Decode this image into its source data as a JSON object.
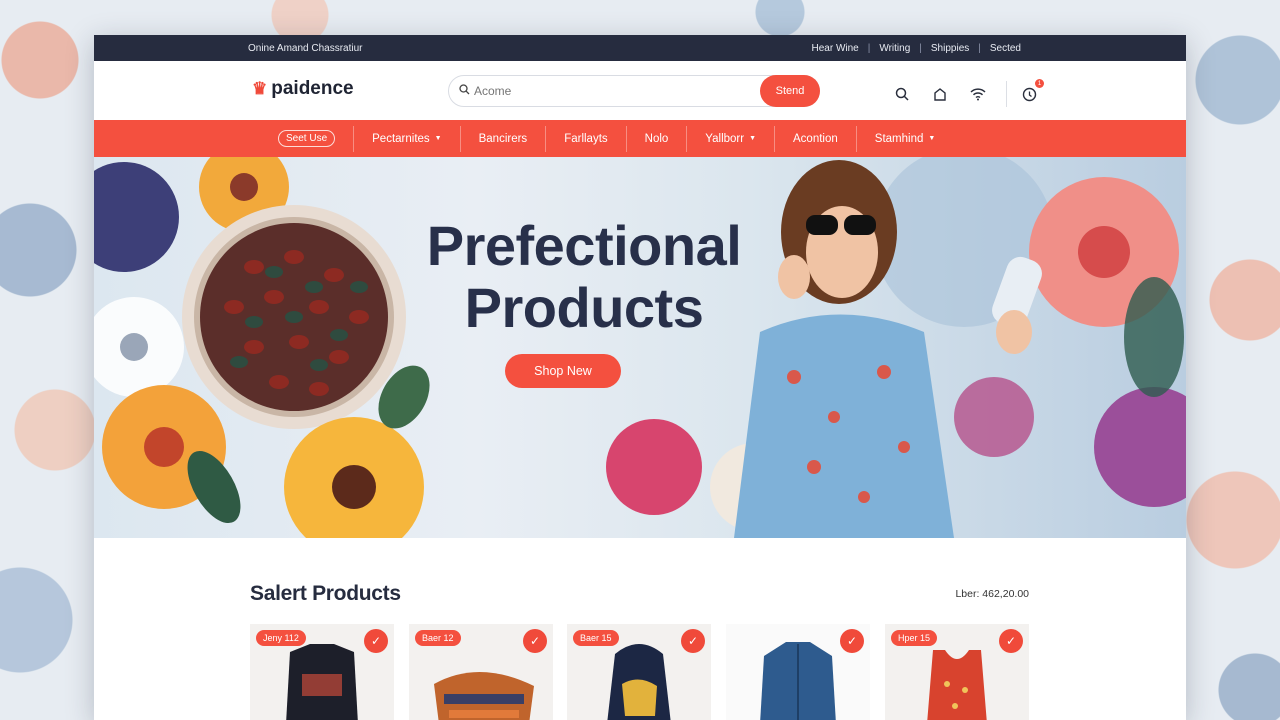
{
  "topbar": {
    "left_text": "Onine Amand Chassratiur",
    "links": [
      "Hear Wine",
      "Writing",
      "Shippies",
      "Sected"
    ]
  },
  "header": {
    "logo_text": "paidence",
    "search_placeholder": "Acome",
    "search_button": "Stend",
    "cart_count": "1"
  },
  "nav": {
    "items": [
      {
        "label": "Seet Use",
        "style": "pill",
        "caret": false
      },
      {
        "label": "Pectarnites",
        "caret": true
      },
      {
        "label": "Bancirers",
        "caret": false
      },
      {
        "label": "Farllayts",
        "caret": false
      },
      {
        "label": "Nolo",
        "caret": false
      },
      {
        "label": "Yallborr",
        "caret": true
      },
      {
        "label": "Acontion",
        "caret": false
      },
      {
        "label": "Stamhind",
        "caret": true
      }
    ]
  },
  "hero": {
    "title_line1": "Prefectional",
    "title_line2": "Products",
    "cta": "Shop New"
  },
  "products": {
    "heading": "Salert Products",
    "total_label": "Lber: 462,20.00",
    "cards": [
      {
        "tag": "Jeny 112",
        "item": "sweatshirt"
      },
      {
        "tag": "Baer 12",
        "item": "sandal"
      },
      {
        "tag": "Baer 15",
        "item": "hoodie"
      },
      {
        "tag": "",
        "item": "denim-jacket"
      },
      {
        "tag": "Hper 15",
        "item": "tank-top"
      }
    ]
  },
  "colors": {
    "accent": "#f4503f",
    "dark": "#262c3f"
  }
}
